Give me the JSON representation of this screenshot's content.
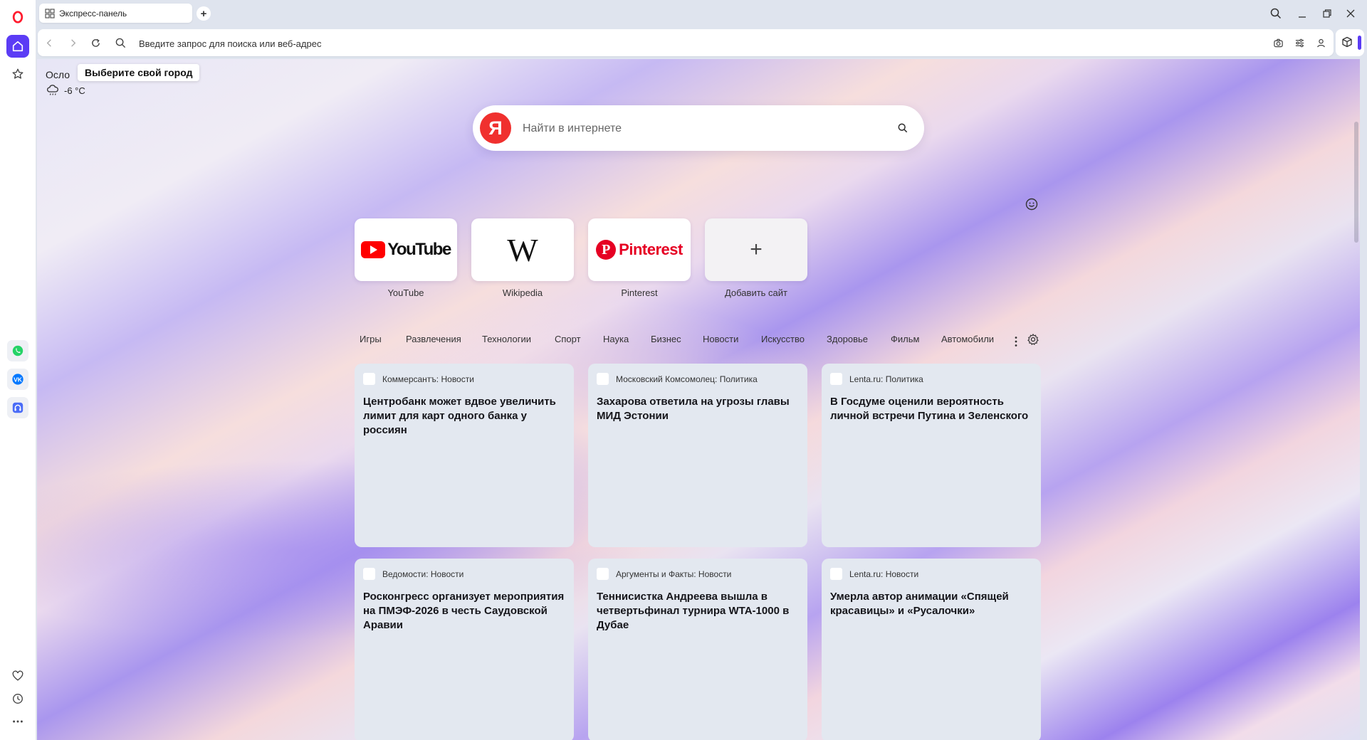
{
  "browser": {
    "tab_title": "Экспресс-панель",
    "new_tab_label": "+",
    "address_placeholder": "Введите запрос для поиска или веб-адрес",
    "accent_color": "#5b3cf5"
  },
  "sidebar": {
    "logo": "opera-icon",
    "top_items": [
      "home-icon",
      "star-icon"
    ],
    "apps": [
      "whatsapp-icon",
      "vk-icon",
      "music-player-icon"
    ],
    "bottom_items": [
      "heart-icon",
      "history-icon",
      "more-icon"
    ]
  },
  "weather": {
    "city": "Осло",
    "tooltip": "Выберите свой город",
    "temperature": "-6 °C",
    "icon": "cloud-snow-icon"
  },
  "search": {
    "logo_letter": "Я",
    "placeholder": "Найти в интернете"
  },
  "speed_dial": [
    {
      "label": "YouTube",
      "logo_text": "YouTube"
    },
    {
      "label": "Wikipedia",
      "logo_text": "W"
    },
    {
      "label": "Pinterest",
      "logo_text": "Pinterest",
      "logo_letter": "P"
    },
    {
      "label": "Добавить сайт",
      "logo_text": "+"
    }
  ],
  "categories": [
    "Игры",
    "Развлечения",
    "Технологии",
    "Спорт",
    "Наука",
    "Бизнес",
    "Новости",
    "Искусство",
    "Здоровье",
    "Фильм",
    "Автомобили"
  ],
  "news": [
    {
      "source": "Коммерсантъ: Новости",
      "title": "Центробанк может вдвое увеличить лимит для карт одного банка у россиян"
    },
    {
      "source": "Московский Комсомолец: Политика",
      "title": "Захарова ответила на угрозы главы МИД Эстонии"
    },
    {
      "source": "Lenta.ru: Политика",
      "title": "В Госдуме оценили вероятность личной встречи Путина и Зеленского"
    },
    {
      "source": "Ведомости: Новости",
      "title": "Росконгресс организует мероприятия на ПМЭФ-2026 в честь Саудовской Аравии"
    },
    {
      "source": "Аргументы и Факты: Новости",
      "title": "Теннисистка Андреева вышла в четвертьфинал турнира WTA-1000 в Дубае"
    },
    {
      "source": "Lenta.ru: Новости",
      "title": "Умерла автор анимации «Спящей красавицы» и «Русалочки»"
    }
  ]
}
